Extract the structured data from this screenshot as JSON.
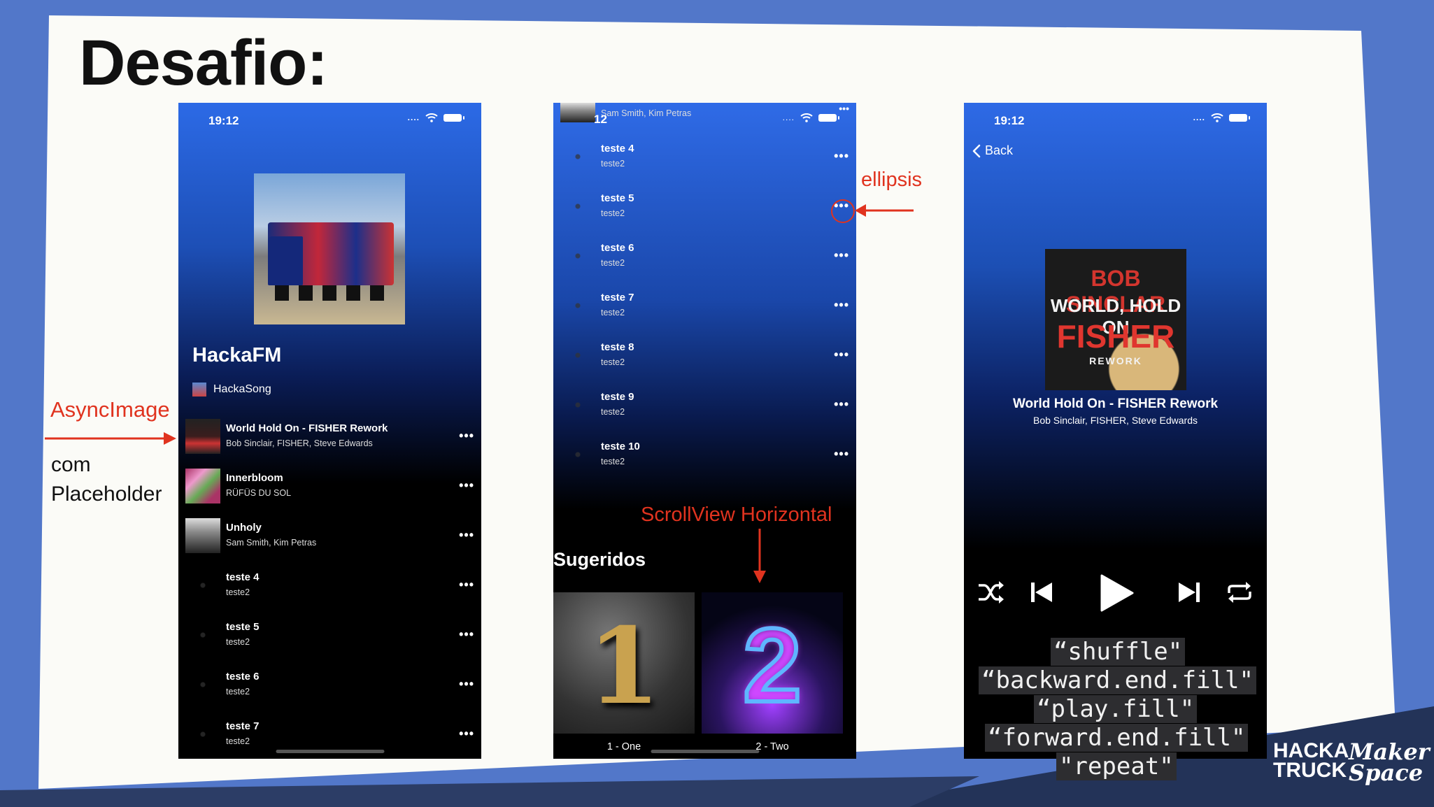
{
  "slide": {
    "title": "Desafio:"
  },
  "phone1": {
    "status_time": "19:12",
    "station": "HackaFM",
    "playlist": "HackaSong",
    "tracks": [
      {
        "title": "World Hold On - FISHER Rework",
        "artist": "Bob Sinclair, FISHER, Steve Edwards"
      },
      {
        "title": "Innerbloom",
        "artist": "RÜFÜS DU SOL"
      },
      {
        "title": "Unholy",
        "artist": "Sam Smith, Kim Petras"
      },
      {
        "title": "teste 4",
        "artist": "teste2"
      },
      {
        "title": "teste 5",
        "artist": "teste2"
      },
      {
        "title": "teste 6",
        "artist": "teste2"
      },
      {
        "title": "teste 7",
        "artist": "teste2"
      }
    ],
    "more_glyph": "•••"
  },
  "phone2": {
    "status_time": "12",
    "top_partial_artist": "Sam Smith, Kim Petras",
    "tracks": [
      {
        "title": "teste 4",
        "artist": "teste2"
      },
      {
        "title": "teste 5",
        "artist": "teste2"
      },
      {
        "title": "teste 6",
        "artist": "teste2"
      },
      {
        "title": "teste 7",
        "artist": "teste2"
      },
      {
        "title": "teste 8",
        "artist": "teste2"
      },
      {
        "title": "teste 9",
        "artist": "teste2"
      },
      {
        "title": "teste 10",
        "artist": "teste2"
      }
    ],
    "suggested_title": "Sugeridos",
    "suggested": [
      {
        "number": "1",
        "label": "1 - One"
      },
      {
        "number": "2",
        "label": "2 - Two"
      }
    ]
  },
  "phone3": {
    "status_time": "19:12",
    "back_label": "Back",
    "art": {
      "line1": "BOB SINCLAR",
      "line2": "WORLD, HOLD ON",
      "line3": "FISHER",
      "line4": "REWORK"
    },
    "now_title": "World Hold On - FISHER Rework",
    "now_artist": "Bob Sinclair, FISHER, Steve Edwards"
  },
  "annotations": {
    "async_image": "AsyncImage",
    "com": "com",
    "placeholder": "Placeholder",
    "ellipsis": "ellipsis",
    "scrollview": "ScrollView Horizontal",
    "symbols": [
      "“shuffle\"",
      "“backward.end.fill\"",
      "“play.fill\"",
      "“forward.end.fill\"",
      "\"repeat\""
    ]
  },
  "logo": {
    "line1": "HACKA",
    "line2": "TRUCK",
    "script1": "Maker",
    "script2": "Space"
  },
  "colors": {
    "accent_red": "#e0331f",
    "background_blue": "#5277c9"
  }
}
